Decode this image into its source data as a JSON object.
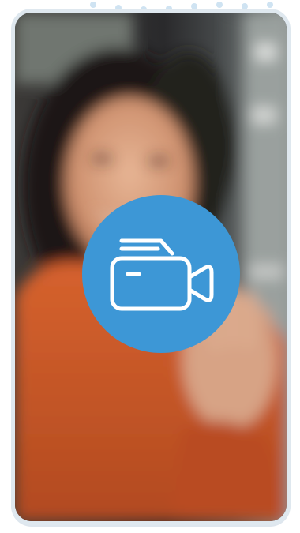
{
  "screen": {
    "name": "video-call-preview",
    "button_icon": "video-camera-icon",
    "accent_color": "#3d97d6",
    "frame_color": "#dfe8ef",
    "photo_palette": {
      "shirt": "#c8582a",
      "skin": "#d9a080",
      "hair": "#1f1814",
      "background_dark": "#2c2b2c",
      "background_light": "#6a6e6c"
    }
  }
}
